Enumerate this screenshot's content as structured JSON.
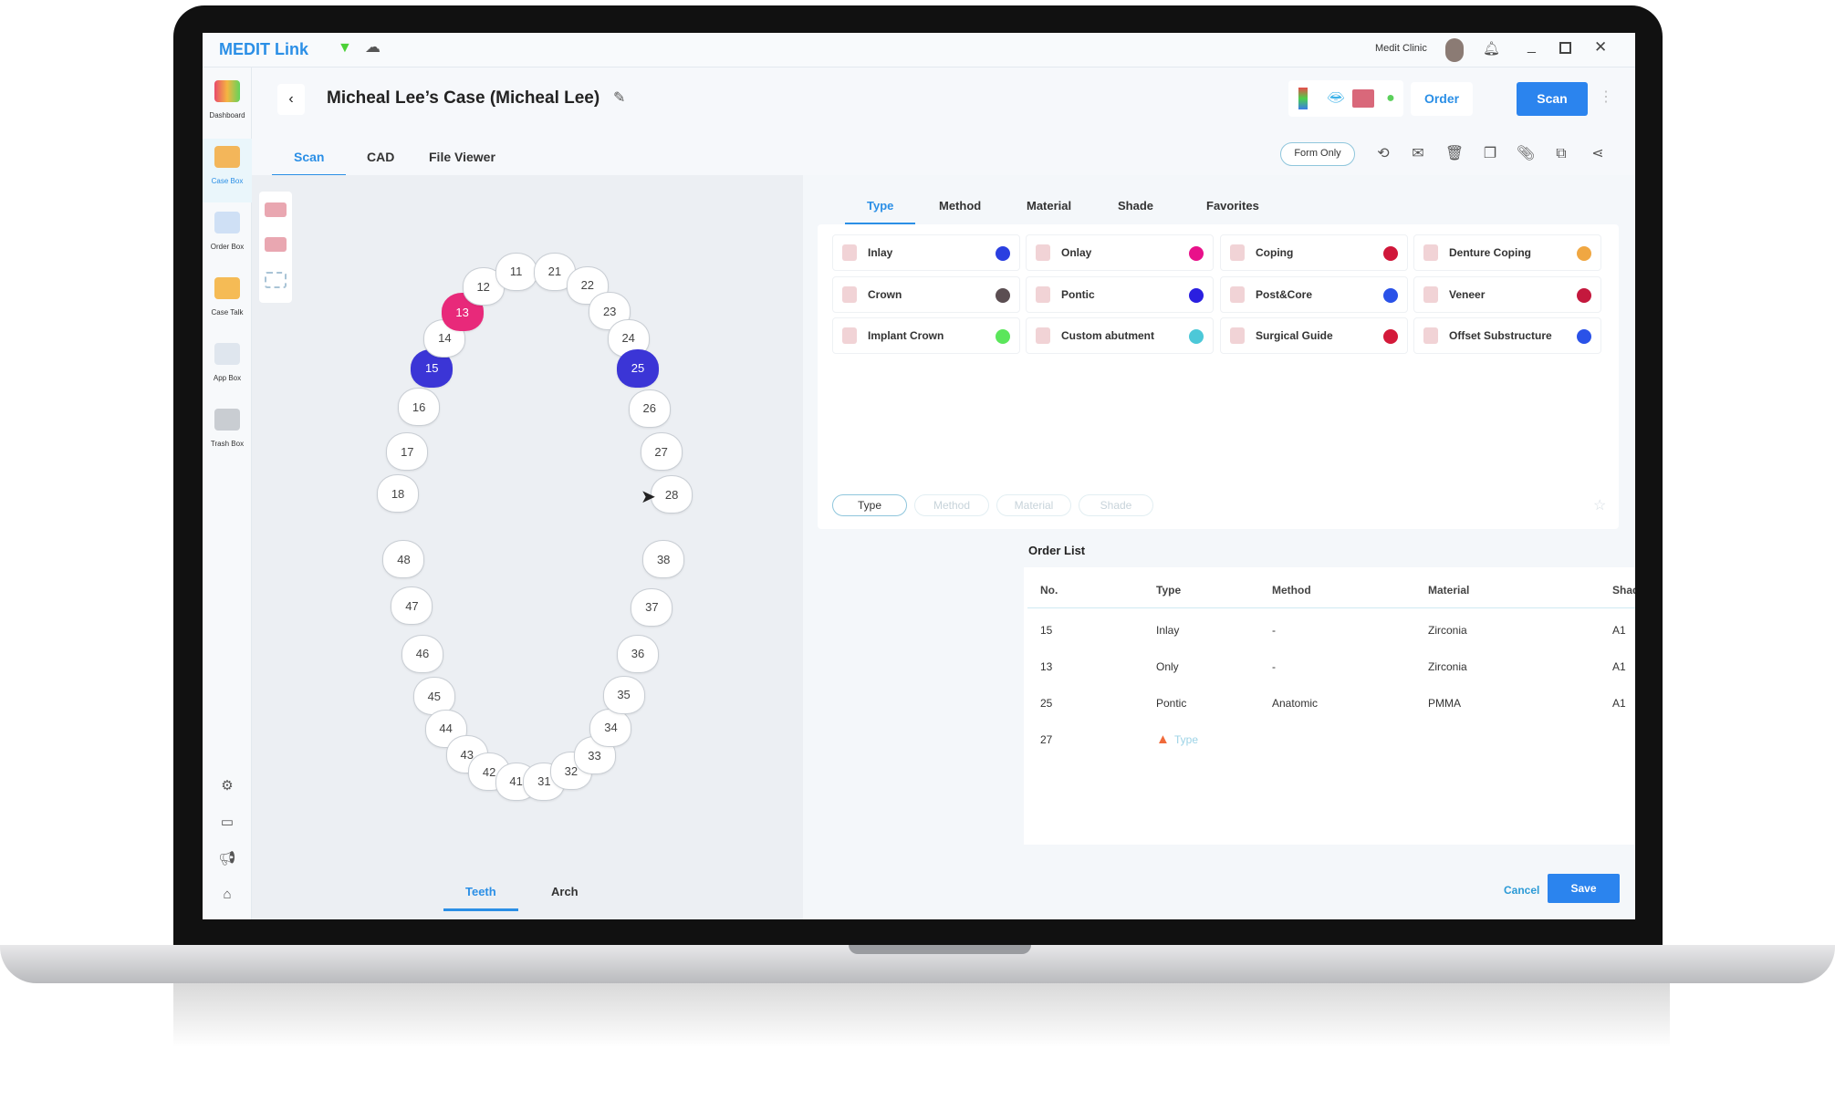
{
  "app": {
    "logo": "MEDIT Link",
    "clinic": "Medit Clinic"
  },
  "sidebar": {
    "items": [
      {
        "label": "Dashboard"
      },
      {
        "label": "Case Box",
        "active": true
      },
      {
        "label": "Order Box"
      },
      {
        "label": "Case Talk"
      },
      {
        "label": "App Box"
      },
      {
        "label": "Trash Box"
      }
    ],
    "bottom_icons": [
      "gear-icon",
      "folder-card-icon",
      "megaphone-icon",
      "home-icon",
      "info-icon"
    ]
  },
  "header": {
    "title": "Micheal Lee’s Case (Micheal Lee)",
    "order_label": "Order",
    "scan_label": "Scan",
    "form_only_label": "Form Only"
  },
  "tabs": [
    {
      "label": "Scan",
      "active": true
    },
    {
      "label": "CAD"
    },
    {
      "label": "File Viewer"
    }
  ],
  "tooth_view_tabs": [
    {
      "label": "Teeth",
      "active": true
    },
    {
      "label": "Arch"
    }
  ],
  "teeth": {
    "upper": [
      "18",
      "17",
      "16",
      "15",
      "14",
      "13",
      "12",
      "11",
      "21",
      "22",
      "23",
      "24",
      "25",
      "26",
      "27",
      "28"
    ],
    "lower": [
      "48",
      "47",
      "46",
      "45",
      "44",
      "43",
      "42",
      "41",
      "31",
      "32",
      "33",
      "34",
      "35",
      "36",
      "37",
      "38"
    ],
    "selected": {
      "13": "#e8297a",
      "15": "#3b35d6",
      "25": "#3b35d6"
    }
  },
  "type_tabs": [
    {
      "label": "Type",
      "active": true
    },
    {
      "label": "Method"
    },
    {
      "label": "Material"
    },
    {
      "label": "Shade"
    },
    {
      "label": "Favorites"
    }
  ],
  "types": [
    {
      "label": "Inlay",
      "color": "#2a3fe0"
    },
    {
      "label": "Onlay",
      "color": "#e8118a"
    },
    {
      "label": "Coping",
      "color": "#d0173a"
    },
    {
      "label": "Denture Coping",
      "color": "#f0a742"
    },
    {
      "label": "Crown",
      "color": "#5b4e52"
    },
    {
      "label": "Pontic",
      "color": "#2a1fe0"
    },
    {
      "label": "Post&Core",
      "color": "#2a52e8"
    },
    {
      "label": "Veneer",
      "color": "#c4183d"
    },
    {
      "label": "Implant Crown",
      "color": "#5be65b"
    },
    {
      "label": "Custom abutment",
      "color": "#4cc8d8"
    },
    {
      "label": "Surgical Guide",
      "color": "#d41a3a"
    },
    {
      "label": "Offset Substructure",
      "color": "#2a52e8"
    }
  ],
  "filter_pills": [
    {
      "label": "Type",
      "active": true
    },
    {
      "label": "Method"
    },
    {
      "label": "Material"
    },
    {
      "label": "Shade"
    }
  ],
  "order_list": {
    "title": "Order List",
    "columns": [
      "No.",
      "Type",
      "Method",
      "Material",
      "Shade"
    ],
    "rows": [
      {
        "no": "15",
        "type": "Inlay",
        "method": "-",
        "material": "Zirconia",
        "shade": "A1"
      },
      {
        "no": "13",
        "type": "Only",
        "method": "-",
        "material": "Zirconia",
        "shade": "A1"
      },
      {
        "no": "25",
        "type": "Pontic",
        "method": "Anatomic",
        "material": "PMMA",
        "shade": "A1"
      },
      {
        "no": "27",
        "type": "Type",
        "warning": true
      }
    ]
  },
  "footer": {
    "cancel_label": "Cancel",
    "save_label": "Save"
  },
  "colors": {
    "accent": "#2b8fe6"
  }
}
